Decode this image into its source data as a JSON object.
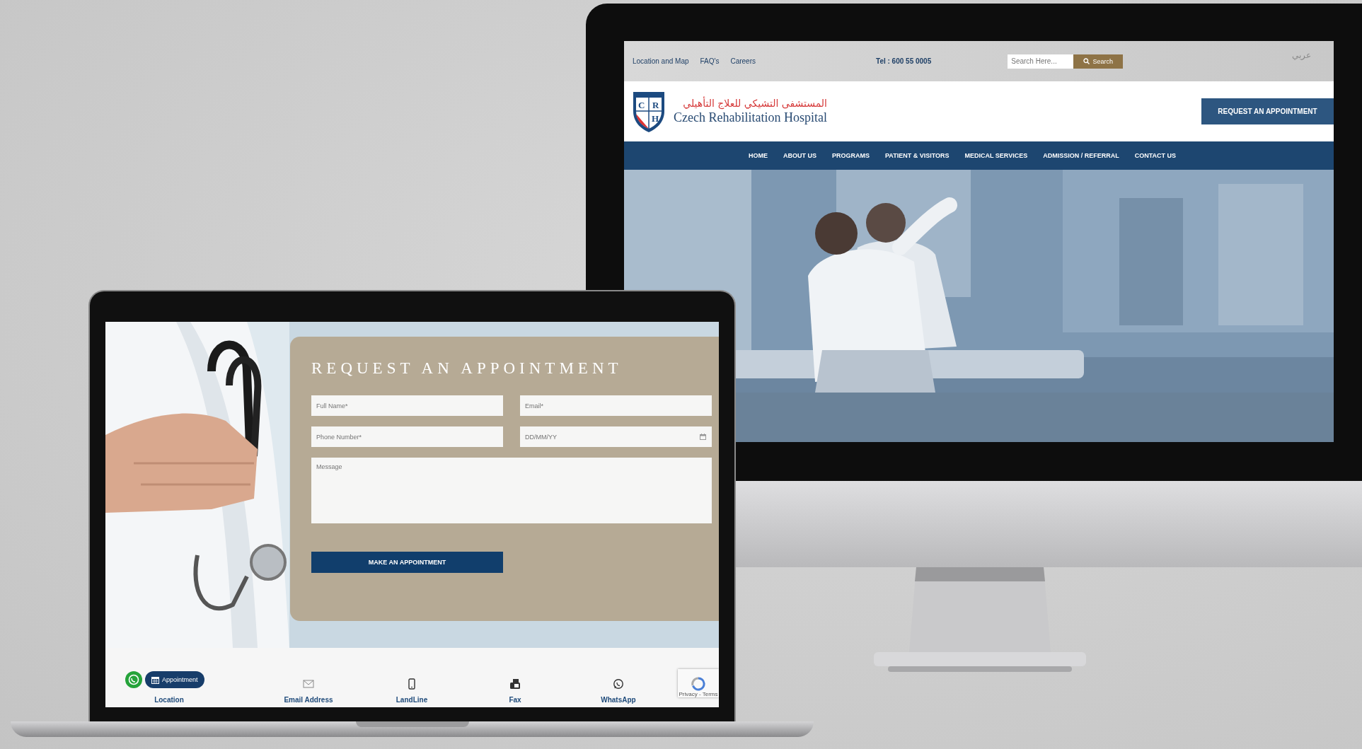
{
  "monitor": {
    "top_links": [
      "Location and Map",
      "FAQ's",
      "Careers"
    ],
    "phone": "Tel : 600 55 0005",
    "search": {
      "placeholder": "Search Here...",
      "button": "Search"
    },
    "language": "عربي",
    "logo": {
      "letters": [
        "C",
        "R",
        "H"
      ],
      "arabic": "المستشفى التشيكي للعلاج التأهيلي",
      "name": "Czech Rehabilitation Hospital"
    },
    "request_button": "REQUEST AN APPOINTMENT",
    "nav": [
      "HOME",
      "ABOUT US",
      "PROGRAMS",
      "PATIENT & VISITORS",
      "MEDICAL SERVICES",
      "ADMISSION / REFERRAL",
      "CONTACT US"
    ]
  },
  "laptop": {
    "form": {
      "title": "REQUEST AN APPOINTMENT",
      "fields": [
        {
          "kind": "text",
          "placeholder": "Full Name*"
        },
        {
          "kind": "text",
          "placeholder": "Email*"
        },
        {
          "kind": "text",
          "placeholder": "Phone Number*"
        },
        {
          "kind": "date",
          "placeholder": "DD/MM/YY"
        },
        {
          "kind": "textarea",
          "placeholder": "Message"
        }
      ],
      "submit": "MAKE AN APPOINTMENT"
    },
    "appointment_button": "Appointment",
    "contacts": [
      {
        "label": "Location"
      },
      {
        "label": "Email Address",
        "kind": "mail"
      },
      {
        "label": "LandLine",
        "kind": "mobile"
      },
      {
        "label": "Fax",
        "kind": "fax"
      },
      {
        "label": "WhatsApp",
        "kind": "whatsapp"
      }
    ],
    "recaptcha": "Privacy - Terms"
  }
}
